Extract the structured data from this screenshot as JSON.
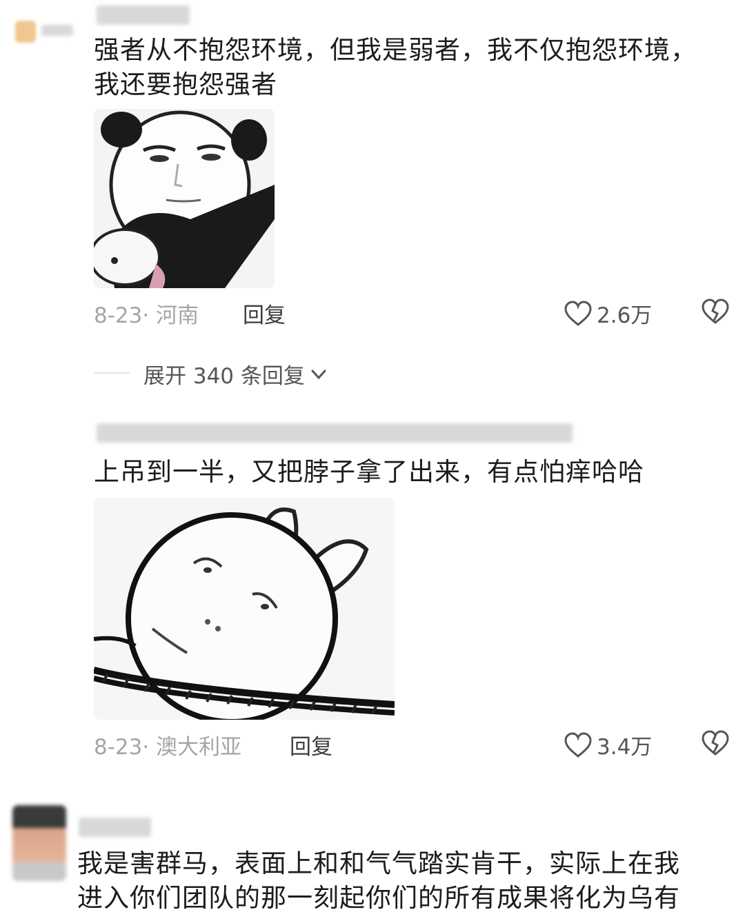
{
  "comments": [
    {
      "text_line1": "强者从不抱怨环境，但我是弱者，我不仅抱怨环境，",
      "text_line2": "我还要抱怨强者",
      "date_location": "8-23· 河南",
      "reply_label": "回复",
      "likes": "2.6万",
      "sticker_icon": "panda-meme-sticker"
    },
    {
      "text": "上吊到一半，又把脖子拿了出来，有点怕痒哈哈",
      "date_location": "8-23· 澳大利亚",
      "reply_label": "回复",
      "likes": "3.4万",
      "sticker_icon": "rabbit-rope-sticker"
    },
    {
      "text_line1": "我是害群马，表面上和和气气踏实肯干，实际上在我",
      "text_line2": "进入你们团队的那一刻起你们的所有成果将化为乌有"
    }
  ],
  "expand_replies": "展开 340 条回复",
  "icons": {
    "like": "heart-outline-icon",
    "dislike": "broken-heart-icon",
    "expand": "chevron-down-icon"
  }
}
